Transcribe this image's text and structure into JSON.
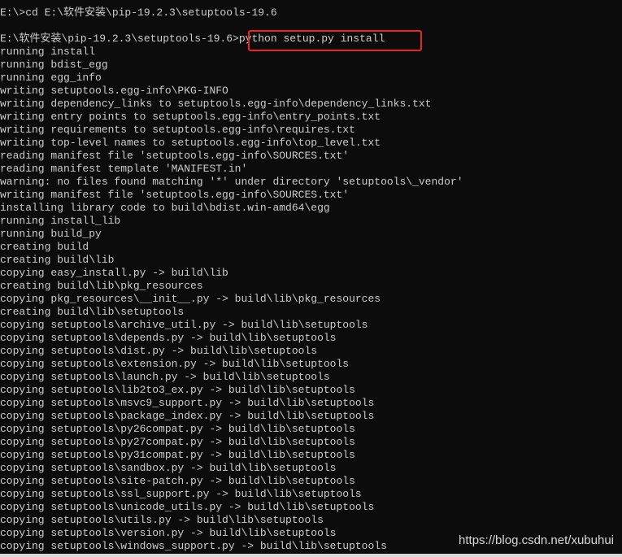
{
  "console": {
    "lines": [
      "E:\\>cd E:\\软件安装\\pip-19.2.3\\setuptools-19.6",
      "",
      "E:\\软件安装\\pip-19.2.3\\setuptools-19.6>python setup.py install",
      "running install",
      "running bdist_egg",
      "running egg_info",
      "writing setuptools.egg-info\\PKG-INFO",
      "writing dependency_links to setuptools.egg-info\\dependency_links.txt",
      "writing entry points to setuptools.egg-info\\entry_points.txt",
      "writing requirements to setuptools.egg-info\\requires.txt",
      "writing top-level names to setuptools.egg-info\\top_level.txt",
      "reading manifest file 'setuptools.egg-info\\SOURCES.txt'",
      "reading manifest template 'MANIFEST.in'",
      "warning: no files found matching '*' under directory 'setuptools\\_vendor'",
      "writing manifest file 'setuptools.egg-info\\SOURCES.txt'",
      "installing library code to build\\bdist.win-amd64\\egg",
      "running install_lib",
      "running build_py",
      "creating build",
      "creating build\\lib",
      "copying easy_install.py -> build\\lib",
      "creating build\\lib\\pkg_resources",
      "copying pkg_resources\\__init__.py -> build\\lib\\pkg_resources",
      "creating build\\lib\\setuptools",
      "copying setuptools\\archive_util.py -> build\\lib\\setuptools",
      "copying setuptools\\depends.py -> build\\lib\\setuptools",
      "copying setuptools\\dist.py -> build\\lib\\setuptools",
      "copying setuptools\\extension.py -> build\\lib\\setuptools",
      "copying setuptools\\launch.py -> build\\lib\\setuptools",
      "copying setuptools\\lib2to3_ex.py -> build\\lib\\setuptools",
      "copying setuptools\\msvc9_support.py -> build\\lib\\setuptools",
      "copying setuptools\\package_index.py -> build\\lib\\setuptools",
      "copying setuptools\\py26compat.py -> build\\lib\\setuptools",
      "copying setuptools\\py27compat.py -> build\\lib\\setuptools",
      "copying setuptools\\py31compat.py -> build\\lib\\setuptools",
      "copying setuptools\\sandbox.py -> build\\lib\\setuptools",
      "copying setuptools\\site-patch.py -> build\\lib\\setuptools",
      "copying setuptools\\ssl_support.py -> build\\lib\\setuptools",
      "copying setuptools\\unicode_utils.py -> build\\lib\\setuptools",
      "copying setuptools\\utils.py -> build\\lib\\setuptools",
      "copying setuptools\\version.py -> build\\lib\\setuptools",
      "copying setuptools\\windows_support.py -> build\\lib\\setuptools"
    ]
  },
  "watermark": "https://blog.csdn.net/xubuhui",
  "colors": {
    "background": "#0c0c0c",
    "text": "#cccccc",
    "highlight": "#e8262a"
  }
}
